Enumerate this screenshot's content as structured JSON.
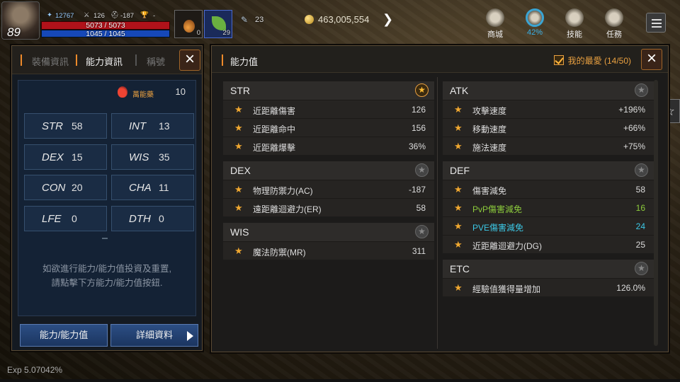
{
  "hud": {
    "level": "89",
    "power": "12767",
    "stat_a": "126",
    "stat_b": "-187",
    "trophy": "-",
    "hp": "5073 / 5073",
    "mp": "1045 / 1045",
    "slot1_count": "0",
    "slot2_count": "29",
    "scroll_count": "23",
    "gold": "463,005,554",
    "shop_label": "商城",
    "weight_label": "42%",
    "skills_label": "技能",
    "quests_label": "任務"
  },
  "left_panel": {
    "tabs": [
      "裝備資訊",
      "能力資訊",
      "稱號"
    ],
    "active_tab": 1,
    "points_label": "萬能藥",
    "points_value": "10",
    "stats": [
      {
        "key": "STR",
        "value": "58"
      },
      {
        "key": "INT",
        "value": "13"
      },
      {
        "key": "DEX",
        "value": "15"
      },
      {
        "key": "WIS",
        "value": "35"
      },
      {
        "key": "CON",
        "value": "20"
      },
      {
        "key": "CHA",
        "value": "11"
      },
      {
        "key": "LFE",
        "value": "0"
      },
      {
        "key": "DTH",
        "value": "0"
      }
    ],
    "hint": "如欲進行能力/能力值投資及重置,\n請點擊下方能力/能力值按鈕.",
    "btn_ability": "能力/能力值",
    "btn_detail": "詳細資料"
  },
  "right_panel": {
    "title": "能力值",
    "favorites": "我的最愛 (14/50)",
    "left_groups": [
      {
        "name": "STR",
        "starred": true,
        "rows": [
          {
            "label": "近距離傷害",
            "value": "126"
          },
          {
            "label": "近距離命中",
            "value": "156"
          },
          {
            "label": "近距離爆擊",
            "value": "36%"
          }
        ]
      },
      {
        "name": "DEX",
        "starred": false,
        "rows": [
          {
            "label": "物理防禦力(AC)",
            "value": "-187"
          },
          {
            "label": "遠距離迴避力(ER)",
            "value": "58"
          }
        ]
      },
      {
        "name": "WIS",
        "starred": false,
        "rows": [
          {
            "label": "魔法防禦(MR)",
            "value": "311"
          }
        ]
      }
    ],
    "right_groups": [
      {
        "name": "ATK",
        "starred": false,
        "rows": [
          {
            "label": "攻擊速度",
            "value": "+196%"
          },
          {
            "label": "移動速度",
            "value": "+66%"
          },
          {
            "label": "施法速度",
            "value": "+75%"
          }
        ]
      },
      {
        "name": "DEF",
        "starred": false,
        "rows": [
          {
            "label": "傷害減免",
            "value": "58"
          },
          {
            "label": "PvP傷害減免",
            "value": "16",
            "color": "green"
          },
          {
            "label": "PVE傷害減免",
            "value": "24",
            "color": "cyan"
          },
          {
            "label": "近距離迴避力(DG)",
            "value": "25"
          }
        ]
      },
      {
        "name": "ETC",
        "starred": false,
        "rows": [
          {
            "label": "經驗值獲得量增加",
            "value": "126.0%"
          }
        ]
      }
    ]
  },
  "footer": {
    "exp": "Exp  5.07042%"
  },
  "colors": {
    "accent": "#e9a040",
    "hp": "#b0121a",
    "mp": "#1648b8",
    "button": "#2c4e84"
  }
}
